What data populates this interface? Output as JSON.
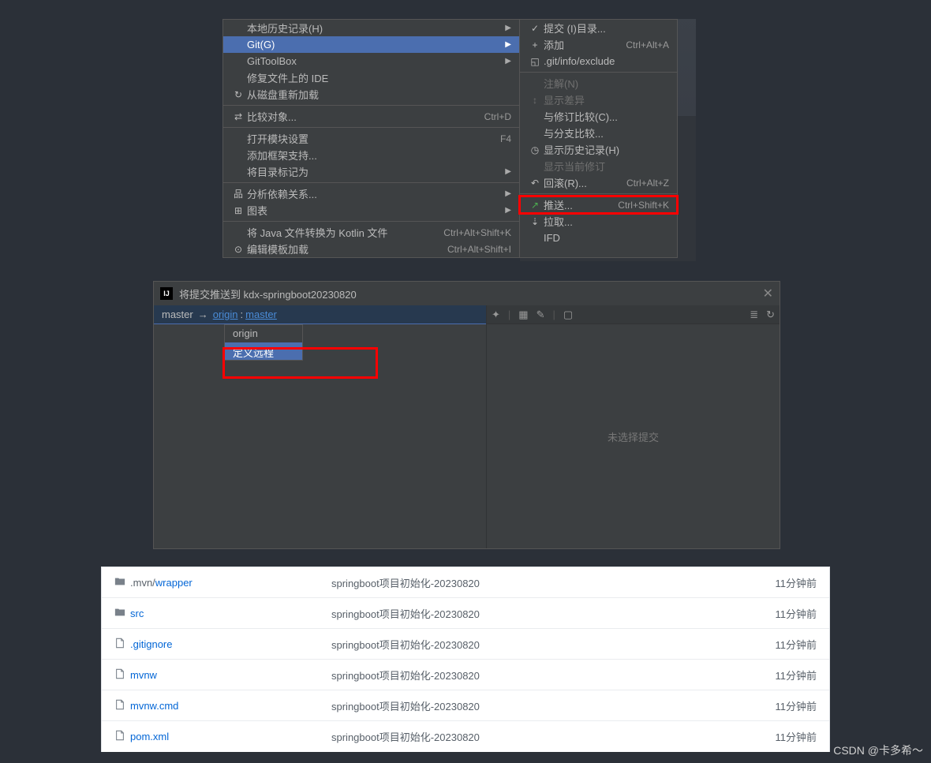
{
  "context_menu": {
    "left": [
      {
        "icon": "",
        "label": "本地历史记录(H)",
        "arrow": true
      },
      {
        "icon": "",
        "label": "Git(G)",
        "arrow": true,
        "selected": true
      },
      {
        "icon": "",
        "label": "GitToolBox",
        "arrow": true
      },
      {
        "icon": "",
        "label": "修复文件上的 IDE"
      },
      {
        "icon": "↻",
        "label": "从磁盘重新加载"
      },
      {
        "sep": true
      },
      {
        "icon": "⇄",
        "label": "比较对象...",
        "shortcut": "Ctrl+D"
      },
      {
        "sep": true
      },
      {
        "icon": "",
        "label": "打开模块设置",
        "shortcut": "F4"
      },
      {
        "icon": "",
        "label": "添加框架支持..."
      },
      {
        "icon": "",
        "label": "将目录标记为",
        "arrow": true
      },
      {
        "sep": true
      },
      {
        "icon": "品",
        "label": "分析依赖关系...",
        "arrow": true
      },
      {
        "icon": "⊞",
        "label": "图表",
        "arrow": true
      },
      {
        "sep": true
      },
      {
        "icon": "",
        "label": "将 Java 文件转换为 Kotlin 文件",
        "shortcut": "Ctrl+Alt+Shift+K"
      },
      {
        "icon": "⊙",
        "label": "编辑模板加载",
        "shortcut": "Ctrl+Alt+Shift+I"
      }
    ],
    "right": [
      {
        "icon": "✓",
        "label": "提交 (I)目录..."
      },
      {
        "icon": "+",
        "label": "添加",
        "shortcut": "Ctrl+Alt+A"
      },
      {
        "icon": "◱",
        "label": ".git/info/exclude"
      },
      {
        "sep": true
      },
      {
        "icon": "",
        "label": "注解(N)",
        "disabled": true
      },
      {
        "icon": "↕",
        "label": "显示差异",
        "disabled": true
      },
      {
        "icon": "",
        "label": "与修订比较(C)..."
      },
      {
        "icon": "",
        "label": "与分支比较..."
      },
      {
        "icon": "◷",
        "label": "显示历史记录(H)"
      },
      {
        "icon": "",
        "label": "显示当前修订",
        "disabled": true
      },
      {
        "icon": "↶",
        "label": "回滚(R)...",
        "shortcut": "Ctrl+Alt+Z"
      },
      {
        "sep": true
      },
      {
        "icon": "↗",
        "label": "推送...",
        "shortcut": "Ctrl+Shift+K",
        "push_hl": true
      },
      {
        "icon": "⇣",
        "label": "拉取..."
      },
      {
        "icon": "",
        "label": "IFD"
      }
    ]
  },
  "push_dialog": {
    "title": "将提交推送到 kdx-springboot20230820",
    "close": "✕",
    "branch_from": "master",
    "arrow": "→",
    "remote": "origin",
    "colon": ":",
    "branch_to": "master",
    "popup": {
      "opt1": "origin",
      "opt2": "定义远程"
    },
    "no_commit": "未选择提交",
    "tb": {
      "pin": "✦",
      "grid": "▦",
      "edit": "✎",
      "view": "▢",
      "hist1": "≣",
      "hist2": "↻"
    }
  },
  "file_list": [
    {
      "type": "dir",
      "name_prefix": ".mvn/",
      "name": "wrapper",
      "msg": "springboot项目初始化-20230820",
      "time": "11分钟前"
    },
    {
      "type": "dir",
      "name": "src",
      "msg": "springboot项目初始化-20230820",
      "time": "11分钟前"
    },
    {
      "type": "file",
      "name": ".gitignore",
      "msg": "springboot项目初始化-20230820",
      "time": "11分钟前"
    },
    {
      "type": "file",
      "name": "mvnw",
      "msg": "springboot项目初始化-20230820",
      "time": "11分钟前"
    },
    {
      "type": "file",
      "name": "mvnw.cmd",
      "msg": "springboot项目初始化-20230820",
      "time": "11分钟前"
    },
    {
      "type": "file",
      "name": "pom.xml",
      "msg": "springboot项目初始化-20230820",
      "time": "11分钟前"
    }
  ],
  "watermark": "CSDN @卡多希～"
}
